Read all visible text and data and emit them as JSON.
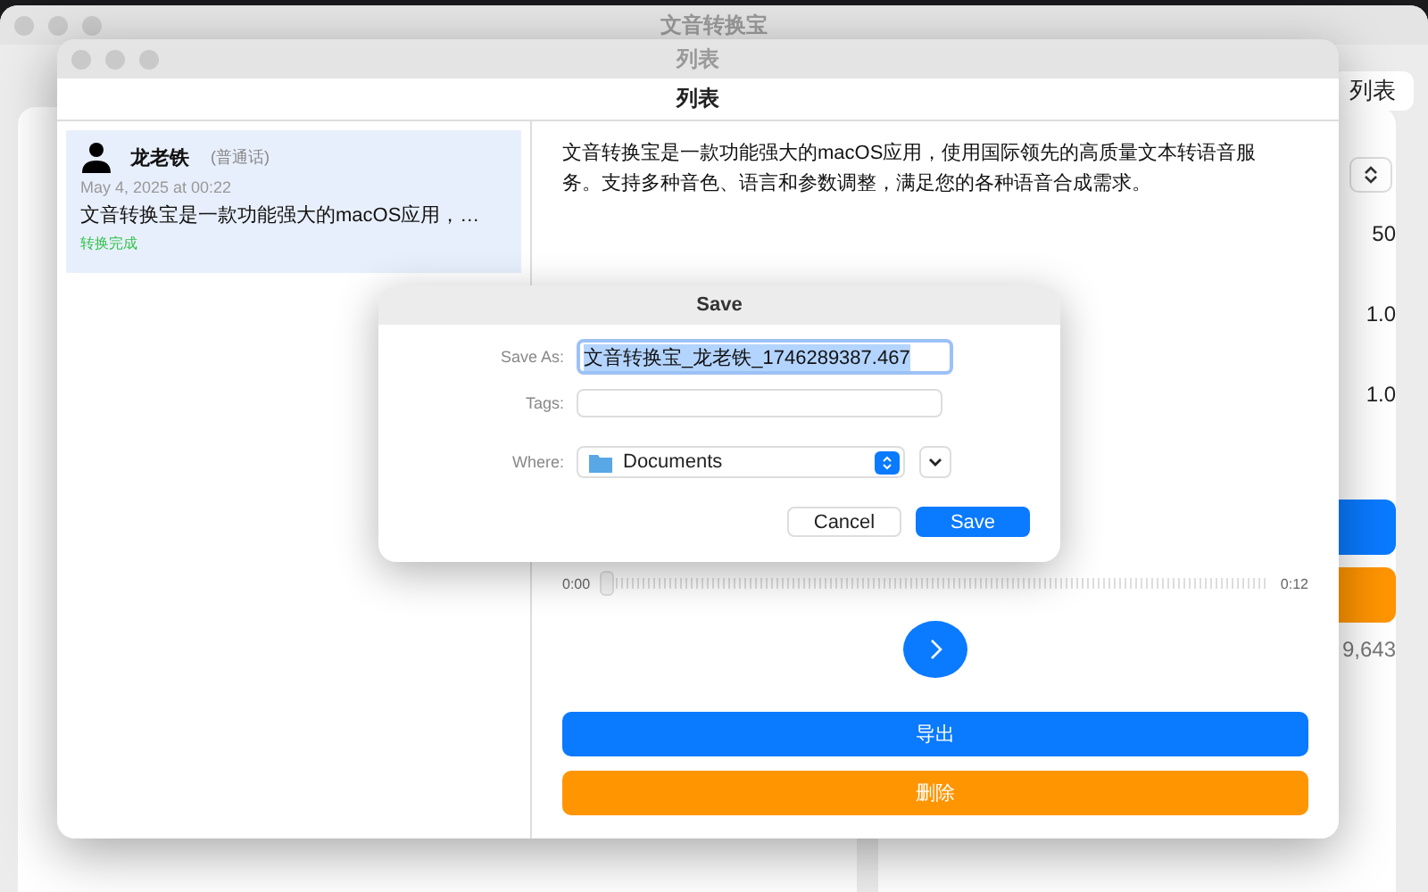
{
  "main_window": {
    "title": "文音转换宝",
    "header_button": "列表",
    "values": [
      "50",
      "1.0",
      "1.0"
    ],
    "count": "9,643"
  },
  "list_window": {
    "title": "列表",
    "header": "列表",
    "items": [
      {
        "name": "龙老铁",
        "tag": "(普通话)",
        "date": "May 4, 2025 at 00:22",
        "preview": "文音转换宝是一款功能强大的macOS应用，…",
        "status": "转换完成",
        "selected": true
      }
    ],
    "detail": {
      "text": "文音转换宝是一款功能强大的macOS应用，使用国际领先的高质量文本转语音服务。支持多种音色、语言和参数调整，满足您的各种语音合成需求。",
      "player": {
        "elapsed": "0:00",
        "duration": "0:12",
        "level": 0
      },
      "buttons": [
        {
          "label": "导出",
          "kind": "primary"
        },
        {
          "label": "删除",
          "kind": "destructive"
        }
      ]
    }
  },
  "save_sheet": {
    "title": "Save",
    "save_as": {
      "label": "Save As:",
      "value": "文音转换宝_龙老铁_1746289387.467"
    },
    "tags": {
      "label": "Tags:"
    },
    "where": {
      "label": "Where:",
      "value": "Documents"
    },
    "buttons": [
      {
        "label": "Cancel",
        "kind": "secondary"
      },
      {
        "label": "Save",
        "kind": "default"
      }
    ]
  }
}
